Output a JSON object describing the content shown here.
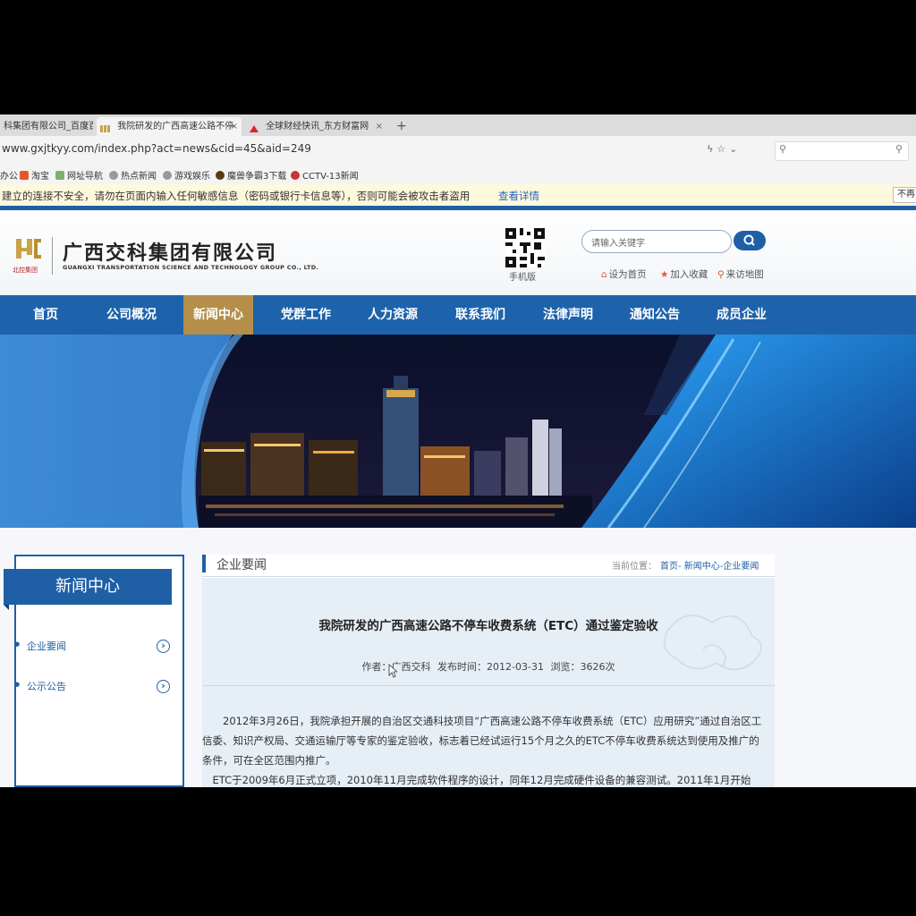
{
  "browser": {
    "tabs": [
      {
        "title": "科集团有限公司_百度百",
        "active": false
      },
      {
        "title": "我院研发的广西高速公路不停",
        "active": true
      },
      {
        "title": "全球财经快讯_东方财富网",
        "active": false
      }
    ],
    "new_tab": "+",
    "url": "www.gxjtkyy.com/index.php?act=news&cid=45&aid=249",
    "bookmarks": [
      "办公",
      "淘宝",
      "网址导航",
      "热点新闻",
      "游戏娱乐",
      "魔兽争霸3下载",
      "CCTV-13新闻"
    ],
    "security_warning": "建立的连接不安全，请勿在页面内输入任何敏感信息（密码或银行卡信息等），否则可能会被攻击者盗用",
    "security_link": "查看详情",
    "security_button": "不再"
  },
  "site": {
    "logo_mark_text": "北控集团",
    "company_cn": "广西交科集团有限公司",
    "company_en": "GUANGXI TRANSPORTATION SCIENCE AND TECHNOLOGY GROUP CO., LTD.",
    "mobile_label": "手机版",
    "search_placeholder": "请输入关键字",
    "toplinks": [
      "设为首页",
      "加入收藏",
      "来访地图"
    ],
    "nav": [
      "首页",
      "公司概况",
      "新闻中心",
      "党群工作",
      "人力资源",
      "联系我们",
      "法律声明",
      "通知公告",
      "成员企业"
    ],
    "nav_active": "新闻中心"
  },
  "sidebar": {
    "title": "新闻中心",
    "items": [
      "企业要闻",
      "公示公告"
    ]
  },
  "main": {
    "section_title": "企业要闻",
    "breadcrumb_label": "当前位置：",
    "breadcrumb": "首页- 新闻中心-企业要闻",
    "article_title": "我院研发的广西高速公路不停车收费系统（ETC）通过鉴定验收",
    "author": "作者：广西交科",
    "published": "发布时间：2012-03-31",
    "views": "浏览：3626次",
    "paragraphs": [
      "2012年3月26日，我院承担开展的自治区交通科技项目“广西高速公路不停车收费系统（ETC）应用研究”通过自治区工信委、知识产权局、交通运输厅等专家的鉴定验收，标志着已经试运行15个月之久的ETC不停车收费系统达到使用及推广的条件，可在全区范围内推广。",
      "ETC于2009年6月正式立项，2010年11月完成软件程序的设计，同年12月完成硬件设备的兼容测试。2011年1月开始"
    ]
  },
  "colors": {
    "primary_blue": "#1f5fa6",
    "nav_active_gold": "#b58f4a",
    "warning_bg": "#fff8dc",
    "link_blue": "#2766c4"
  }
}
